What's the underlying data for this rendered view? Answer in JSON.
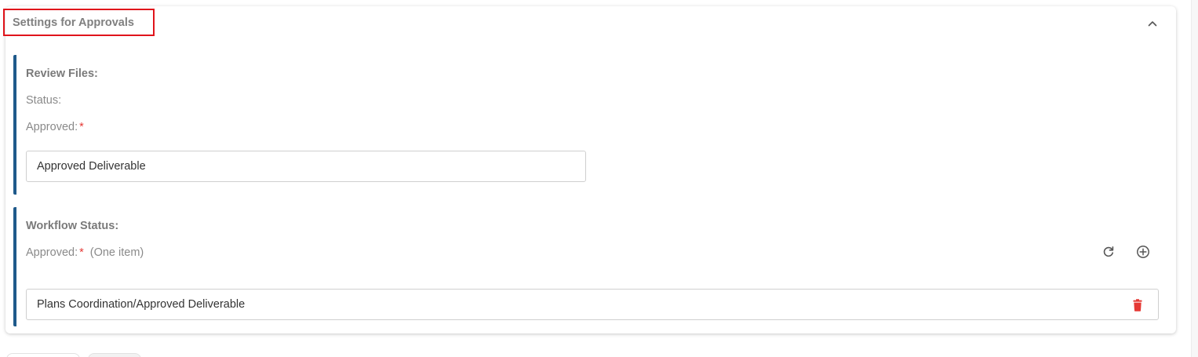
{
  "panel": {
    "title": "Settings for Approvals",
    "collapse_icon": "chevron-up-icon"
  },
  "review_files": {
    "title": "Review Files:",
    "status_label": "Status:",
    "approved_label": "Approved:",
    "required_mark": "*",
    "approved_value": "Approved Deliverable"
  },
  "workflow_status": {
    "title": "Workflow Status:",
    "approved_label": "Approved:",
    "required_mark": "*",
    "item_hint": "(One item)",
    "refresh_icon": "refresh-icon",
    "add_icon": "add-circle-icon",
    "approved_value": "Plans Coordination/Approved Deliverable",
    "delete_icon": "trash-icon"
  },
  "colors": {
    "accent_border": "#1f5a8b",
    "highlight_box": "#e0141b",
    "required": "#e53935",
    "delete": "#e53935"
  }
}
